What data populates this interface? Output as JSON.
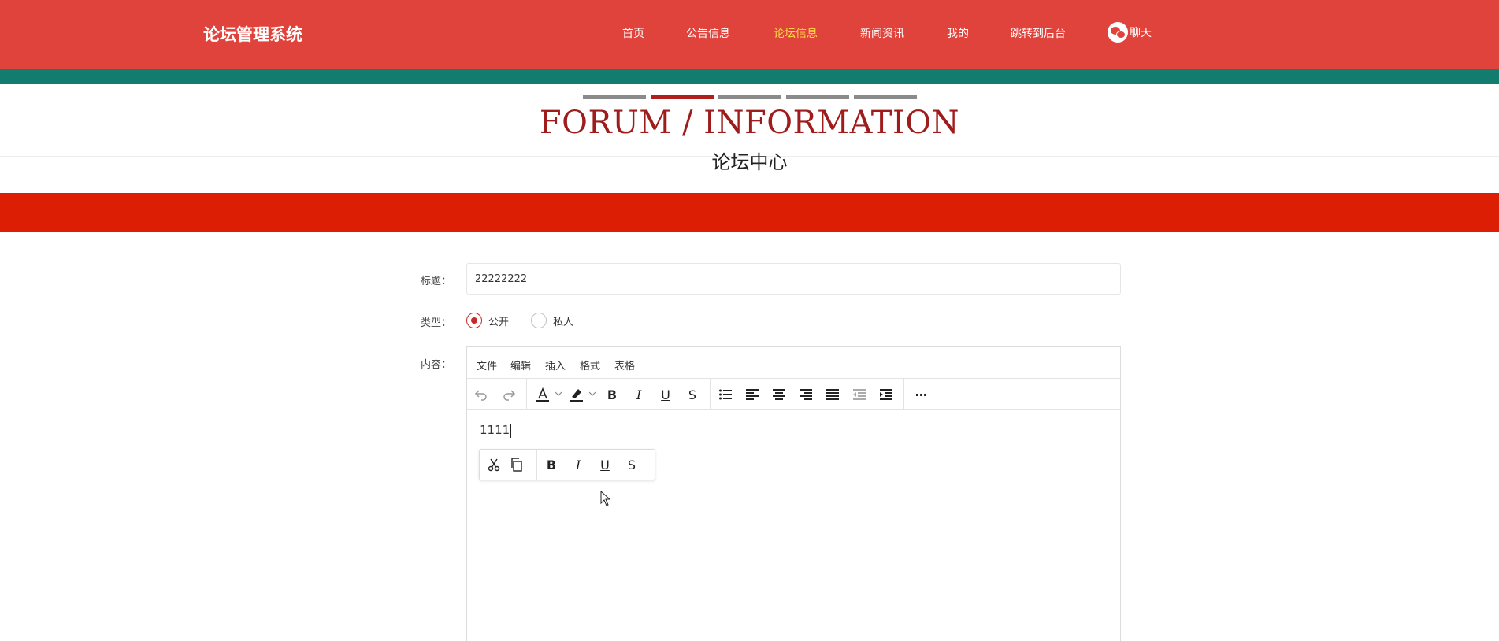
{
  "header": {
    "brand": "论坛管理系统",
    "nav": [
      {
        "label": "首页",
        "active": false
      },
      {
        "label": "公告信息",
        "active": false
      },
      {
        "label": "论坛信息",
        "active": true
      },
      {
        "label": "新闻资讯",
        "active": false
      },
      {
        "label": "我的",
        "active": false
      },
      {
        "label": "跳转到后台",
        "active": false
      }
    ],
    "chat": {
      "label": "聊天",
      "icon": "chat-bubbles-icon"
    },
    "colors": {
      "primary": "#e0433b",
      "teal": "#127c6f",
      "active_nav": "#ffd84a"
    }
  },
  "section": {
    "title_en": "FORUM / INFORMATION",
    "title_cn": "论坛中心",
    "colors": {
      "title": "#9e1c1c",
      "band": "#db1e04"
    }
  },
  "form": {
    "title_label": "标题：",
    "title_value": "22222222",
    "type_label": "类型：",
    "type_options": [
      {
        "label": "公开",
        "checked": true
      },
      {
        "label": "私人",
        "checked": false
      }
    ],
    "content_label": "内容："
  },
  "editor": {
    "menu": [
      "文件",
      "编辑",
      "插入",
      "格式",
      "表格"
    ],
    "toolbar_icons": [
      "undo-icon",
      "redo-icon",
      "font-color-icon",
      "highlight-color-icon",
      "bold-icon",
      "italic-icon",
      "underline-icon",
      "strikethrough-icon",
      "bullet-list-icon",
      "align-left-icon",
      "align-center-icon",
      "align-right-icon",
      "align-justify-icon",
      "outdent-icon",
      "indent-icon",
      "more-icon"
    ],
    "toolbar_text": {
      "bold": "B",
      "italic": "I",
      "underline": "U",
      "strike": "S",
      "font_color": "A",
      "more": "···"
    },
    "content": "1111",
    "inline_toolbar_icons": [
      "cut-icon",
      "copy-icon",
      "bold-icon",
      "italic-icon",
      "underline-icon",
      "strikethrough-icon"
    ]
  }
}
